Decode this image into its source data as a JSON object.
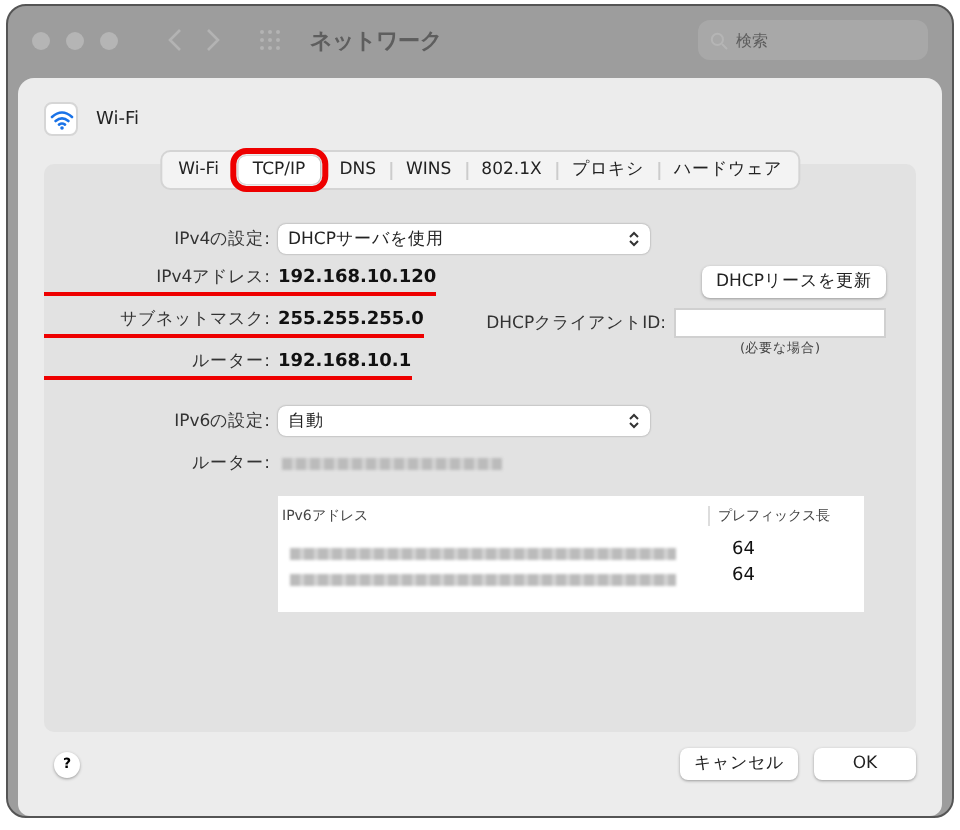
{
  "window": {
    "title": "ネットワーク",
    "search_placeholder": "検索"
  },
  "sheet": {
    "service": "Wi-Fi"
  },
  "tabs": [
    {
      "label": "Wi-Fi",
      "selected": false,
      "highlighted": false
    },
    {
      "label": "TCP/IP",
      "selected": true,
      "highlighted": true
    },
    {
      "label": "DNS",
      "selected": false,
      "highlighted": false
    },
    {
      "label": "WINS",
      "selected": false,
      "highlighted": false
    },
    {
      "label": "802.1X",
      "selected": false,
      "highlighted": false
    },
    {
      "label": "プロキシ",
      "selected": false,
      "highlighted": false
    },
    {
      "label": "ハードウェア",
      "selected": false,
      "highlighted": false
    }
  ],
  "ipv4": {
    "config_label": "IPv4の設定:",
    "config_value": "DHCPサーバを使用",
    "fields": [
      {
        "label": "IPv4アドレス:",
        "value": "192.168.10.120",
        "underlined": true
      },
      {
        "label": "サブネットマスク:",
        "value": "255.255.255.0",
        "underlined": true
      },
      {
        "label": "ルーター:",
        "value": "192.168.10.1",
        "underlined": true
      }
    ],
    "renew_button": "DHCPリースを更新",
    "client_id_label": "DHCPクライアントID:",
    "client_id_hint": "(必要な場合)"
  },
  "ipv6": {
    "config_label": "IPv6の設定:",
    "config_value": "自動",
    "router_label": "ルーター:",
    "table": {
      "columns": [
        "IPv6アドレス",
        "プレフィックス長"
      ],
      "rows": [
        {
          "prefix": "64"
        },
        {
          "prefix": "64"
        }
      ]
    }
  },
  "buttons": {
    "help": "?",
    "cancel": "キャンセル",
    "ok": "OK"
  }
}
